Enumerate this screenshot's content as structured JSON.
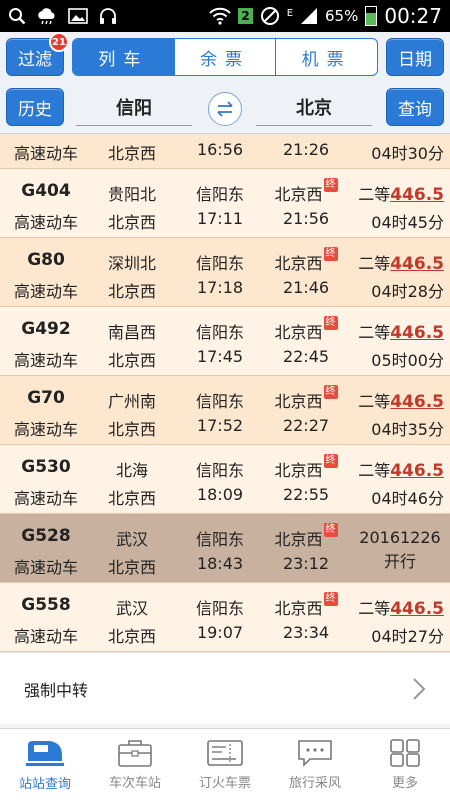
{
  "status_bar": {
    "sim_slot": "2",
    "network": "E",
    "battery": "65%",
    "time": "00:27"
  },
  "controls": {
    "filter_label": "过滤",
    "filter_badge": "21",
    "tabs": [
      {
        "label": "列车",
        "active": true
      },
      {
        "label": "余票",
        "active": false
      },
      {
        "label": "机票",
        "active": false
      }
    ],
    "date_label": "日期",
    "history_label": "历史",
    "from_station": "信阳",
    "to_station": "北京",
    "query_label": "查询"
  },
  "trains": [
    {
      "type": "高速动车",
      "from_line2": "北京西",
      "depart": "16:56",
      "arrive": "21:26",
      "duration": "04时30分",
      "partial": true
    },
    {
      "no": "G404",
      "type": "高速动车",
      "origin": "贵阳北",
      "dest_terminal": "北京西",
      "board": "信阳东",
      "alight": "北京西",
      "depart": "17:11",
      "arrive": "21:56",
      "duration": "04时45分",
      "seat": "二等",
      "price": "446.5",
      "end_mark": "终"
    },
    {
      "no": "G80",
      "type": "高速动车",
      "origin": "深圳北",
      "board": "信阳东",
      "alight": "北京西",
      "depart": "17:18",
      "arrive": "21:46",
      "duration": "04时28分",
      "seat": "二等",
      "price": "446.5",
      "end_mark": "终"
    },
    {
      "no": "G492",
      "type": "高速动车",
      "origin": "南昌西",
      "board": "信阳东",
      "alight": "北京西",
      "depart": "17:45",
      "arrive": "22:45",
      "duration": "05时00分",
      "seat": "二等",
      "price": "446.5",
      "end_mark": "终"
    },
    {
      "no": "G70",
      "type": "高速动车",
      "origin": "广州南",
      "board": "信阳东",
      "alight": "北京西",
      "depart": "17:52",
      "arrive": "22:27",
      "duration": "04时35分",
      "seat": "二等",
      "price": "446.5",
      "end_mark": "终"
    },
    {
      "no": "G530",
      "type": "高速动车",
      "origin": "北海",
      "board": "信阳东",
      "alight": "北京西",
      "depart": "18:09",
      "arrive": "22:55",
      "duration": "04时46分",
      "seat": "二等",
      "price": "446.5",
      "end_mark": "终"
    },
    {
      "no": "G528",
      "type": "高速动车",
      "origin": "武汉",
      "board": "信阳东",
      "alight": "北京西",
      "depart": "18:43",
      "arrive": "23:12",
      "start_date": "20161226",
      "start_note": "开行",
      "end_mark": "终"
    },
    {
      "no": "G558",
      "type": "高速动车",
      "origin": "武汉",
      "board": "信阳东",
      "alight": "北京西",
      "depart": "19:07",
      "arrive": "23:34",
      "duration": "04时27分",
      "seat": "二等",
      "price": "446.5",
      "end_mark": "终"
    }
  ],
  "transfer_label": "强制中转",
  "bottom_nav": [
    {
      "label": "站站查询",
      "icon": "train-icon",
      "active": true
    },
    {
      "label": "车次车站",
      "icon": "briefcase-icon",
      "active": false
    },
    {
      "label": "订火车票",
      "icon": "ticket-icon",
      "active": false
    },
    {
      "label": "旅行采风",
      "icon": "chat-icon",
      "active": false
    },
    {
      "label": "更多",
      "icon": "grid-icon",
      "active": false
    }
  ],
  "colors": {
    "accent": "#2a7ad6",
    "row_peach": "#fde7cf",
    "row_light": "#fff3e5",
    "row_disabled": "#c8b29f",
    "price": "#c0392b"
  }
}
